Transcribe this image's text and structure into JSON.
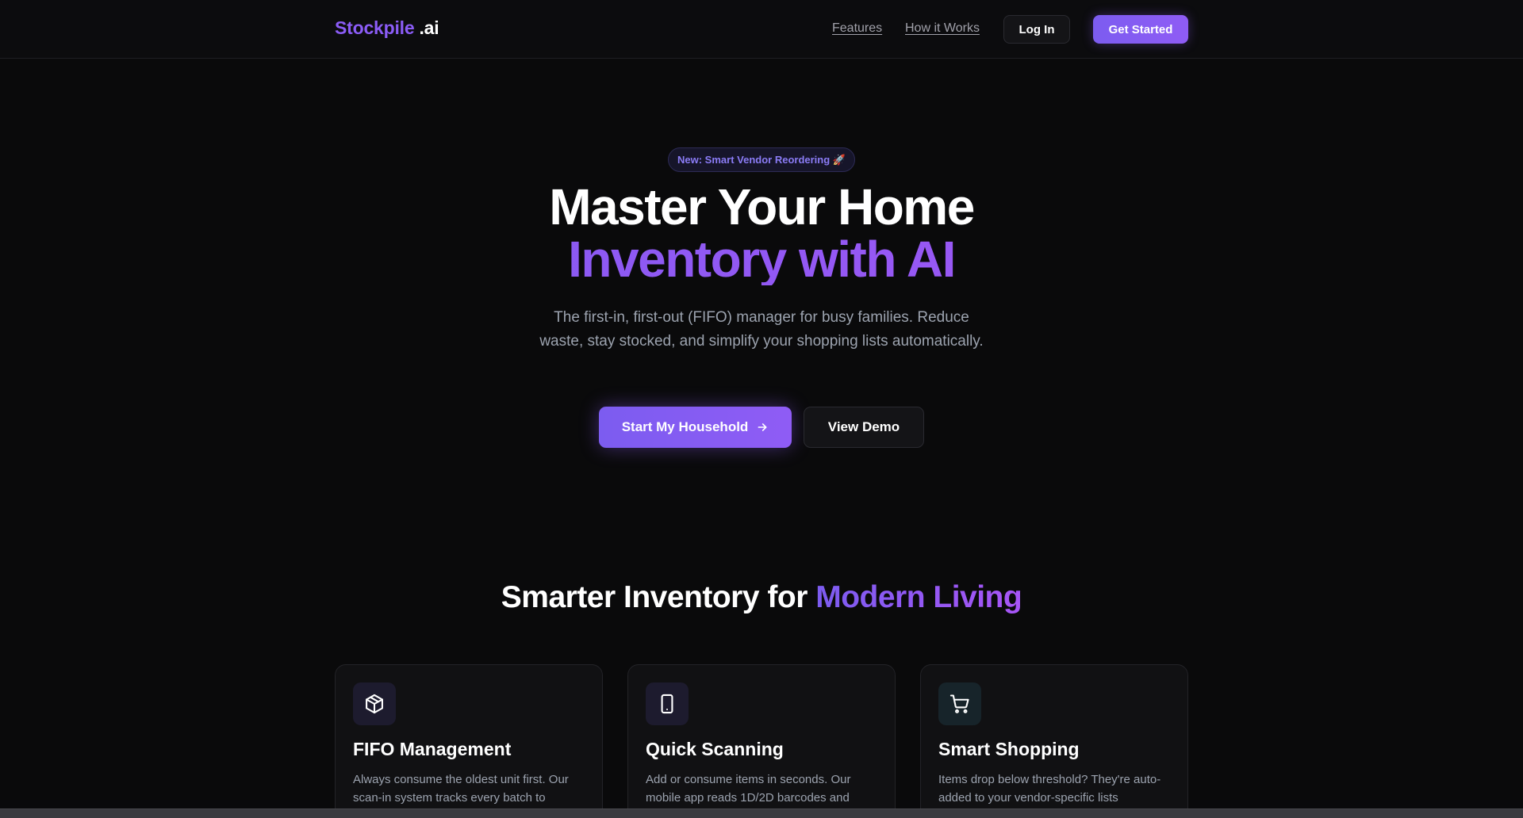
{
  "nav": {
    "brand_main": "Stockpile",
    "brand_suffix": ".ai",
    "links": [
      "Features",
      "How it Works"
    ],
    "login_label": "Log In",
    "cta_label": "Get Started"
  },
  "hero": {
    "badge": "New: Smart Vendor Reordering 🚀",
    "title_line1": "Master Your Home",
    "title_line2": "Inventory with AI",
    "subtitle": "The first-in, first-out (FIFO) manager for busy families. Reduce waste, stay stocked, and simplify your shopping lists automatically.",
    "primary_label": "Start My Household",
    "secondary_label": "View Demo"
  },
  "features": {
    "title_plain": "Smarter Inventory for ",
    "title_accent": "Modern Living",
    "cards": [
      {
        "icon": "box-icon",
        "title": "FIFO Management",
        "desc": "Always consume the oldest unit first. Our scan-in system tracks every batch to"
      },
      {
        "icon": "smartphone-icon",
        "title": "Quick Scanning",
        "desc": "Add or consume items in seconds. Our mobile app reads 1D/2D barcodes and"
      },
      {
        "icon": "cart-icon",
        "title": "Smart Shopping",
        "desc": "Items drop below threshold? They're auto-added to your vendor-specific lists"
      }
    ]
  },
  "colors": {
    "accent": "#8b5cf6",
    "background": "#0a0a0b",
    "card": "#111113"
  }
}
